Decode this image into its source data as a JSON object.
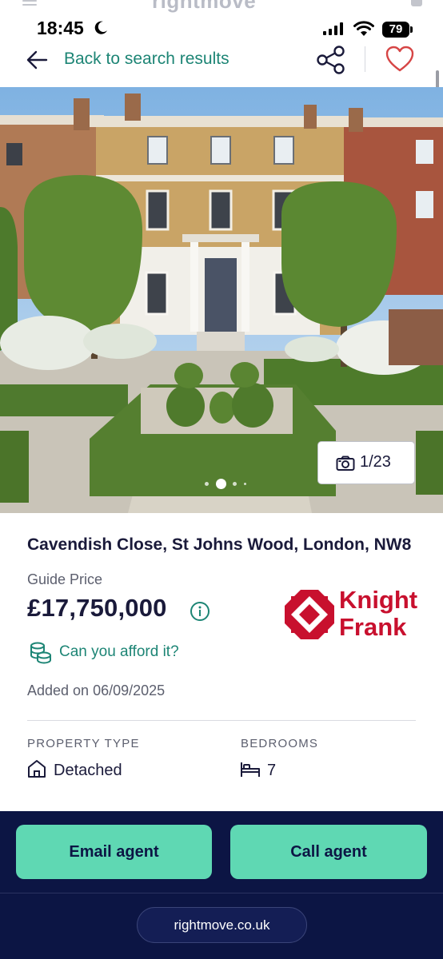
{
  "peek": {
    "brand": "rightmove"
  },
  "status_bar": {
    "time": "18:45",
    "battery": "79"
  },
  "nav": {
    "back_label": "Back to search results"
  },
  "gallery": {
    "counter": "1/23",
    "dot_count": 4,
    "active_dot": 1
  },
  "listing": {
    "address": "Cavendish Close, St Johns Wood, London, NW8",
    "price_qualifier": "Guide Price",
    "price": "£17,750,000",
    "afford_label": "Can you afford it?",
    "added": "Added on 06/09/2025",
    "agent": {
      "line1": "Knight",
      "line2": "Frank",
      "brand_color": "#c8102e"
    }
  },
  "key_facts": [
    {
      "label": "PROPERTY TYPE",
      "value": "Detached",
      "icon": "house-icon"
    },
    {
      "label": "BEDROOMS",
      "value": "7",
      "icon": "bed-icon"
    }
  ],
  "actions": {
    "email": "Email agent",
    "call": "Call agent"
  },
  "browser": {
    "url": "rightmove.co.uk"
  },
  "colors": {
    "accent_teal": "#1d8575",
    "button_green": "#5fd8b3",
    "navy": "#0c1544",
    "text_dark": "#1a1a3a"
  }
}
